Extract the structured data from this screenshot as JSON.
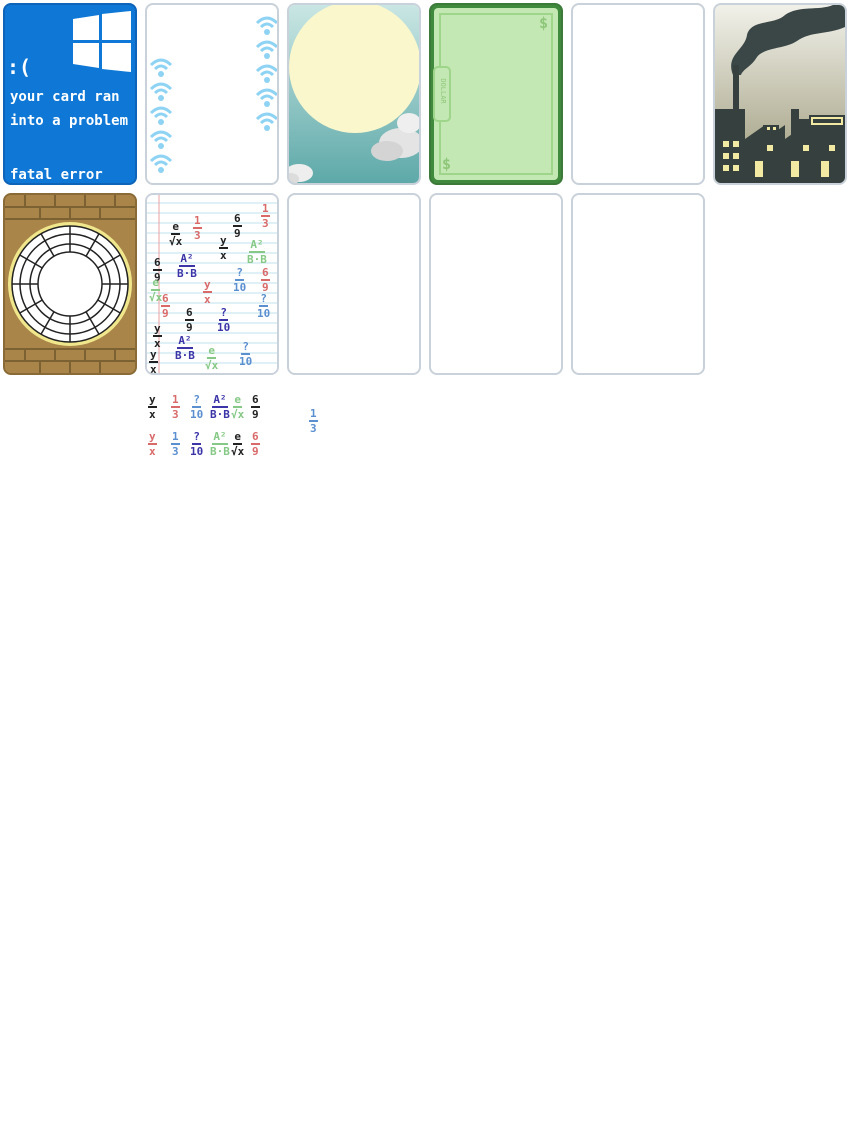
{
  "cards": {
    "error": {
      "face": ":(",
      "line1": "your card ran",
      "line2": "into a problem",
      "footer": "fatal error",
      "bg_color": "#0f78d6",
      "logo_icon": "windows-logo-icon"
    },
    "wifi": {
      "icon": "wifi-icon",
      "color": "#8fd3f4"
    },
    "sky": {
      "icons": [
        "sun-icon",
        "cloud-icon"
      ]
    },
    "money": {
      "symbol": "$",
      "label": "DOLLAR",
      "color": "#c3e8b3"
    },
    "factory": {
      "icons": [
        "factory-icon",
        "smoke-icon"
      ]
    },
    "clock": {
      "icons": [
        "brick-wall-icon",
        "clock-face-icon"
      ]
    },
    "math": {
      "fractions": [
        {
          "num": "e",
          "den": "√x",
          "color": "#222222"
        },
        {
          "num": "1",
          "den": "3",
          "color": "#d96a6a"
        },
        {
          "num": "6",
          "den": "9",
          "color": "#222222"
        },
        {
          "num": "1",
          "den": "3",
          "color": "#d96a6a"
        },
        {
          "num": "y",
          "den": "x",
          "color": "#222222"
        },
        {
          "num": "A²",
          "den": "B·B",
          "color": "#86c986"
        },
        {
          "num": "6",
          "den": "9",
          "color": "#222222"
        },
        {
          "num": "A²",
          "den": "B·B",
          "color": "#3b35a8"
        },
        {
          "num": "?",
          "den": "10",
          "color": "#5a8fd0"
        },
        {
          "num": "6",
          "den": "9",
          "color": "#d96a6a"
        },
        {
          "num": "e",
          "den": "√x",
          "color": "#86c986"
        },
        {
          "num": "6",
          "den": "9",
          "color": "#d96a6a"
        },
        {
          "num": "y",
          "den": "x",
          "color": "#d96a6a"
        },
        {
          "num": "y",
          "den": "x",
          "color": "#222222"
        },
        {
          "num": "?",
          "den": "10",
          "color": "#5a8fd0"
        },
        {
          "num": "6",
          "den": "9",
          "color": "#222222"
        },
        {
          "num": "?",
          "den": "10",
          "color": "#3b35a8"
        },
        {
          "num": "A²",
          "den": "B·B",
          "color": "#3b35a8"
        },
        {
          "num": "e",
          "den": "√x",
          "color": "#86c986"
        },
        {
          "num": "?",
          "den": "10",
          "color": "#5a8fd0"
        },
        {
          "num": "y",
          "den": "x",
          "color": "#222222"
        }
      ]
    }
  },
  "tray": {
    "row1": [
      {
        "num": "y",
        "den": "x",
        "color": "#222222"
      },
      {
        "num": "1",
        "den": "3",
        "color": "#d96a6a"
      },
      {
        "num": "?",
        "den": "10",
        "color": "#5a8fd0"
      },
      {
        "num": "A²",
        "den": "B·B",
        "color": "#3b35a8"
      },
      {
        "num": "e",
        "den": "√x",
        "color": "#86c986"
      },
      {
        "num": "6",
        "den": "9",
        "color": "#222222"
      }
    ],
    "row2": [
      {
        "num": "y",
        "den": "x",
        "color": "#d96a6a"
      },
      {
        "num": "1",
        "den": "3",
        "color": "#5a8fd0"
      },
      {
        "num": "?",
        "den": "10",
        "color": "#3b35a8"
      },
      {
        "num": "A²",
        "den": "B·B",
        "color": "#86c986"
      },
      {
        "num": "e",
        "den": "√x",
        "color": "#222222"
      },
      {
        "num": "6",
        "den": "9",
        "color": "#d96a6a"
      }
    ],
    "loose": {
      "num": "1",
      "den": "3",
      "color": "#5a8fd0"
    }
  }
}
